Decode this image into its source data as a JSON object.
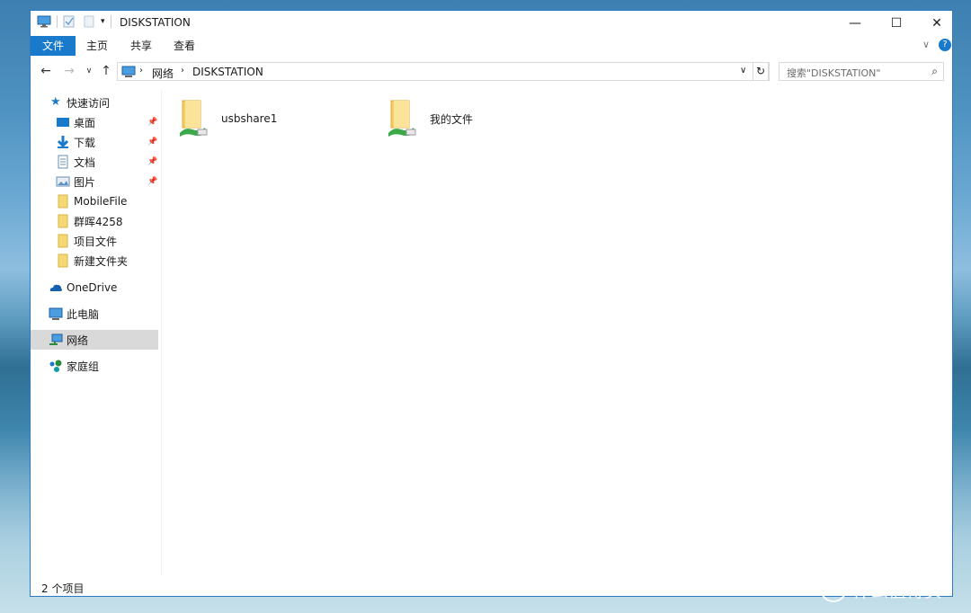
{
  "window": {
    "title": "DISKSTATION",
    "controls": {
      "minimize": "—",
      "maximize": "☐",
      "close": "✕"
    }
  },
  "ribbon": {
    "tabs": [
      "文件",
      "主页",
      "共享",
      "查看"
    ]
  },
  "address": {
    "breadcrumb": [
      "网络",
      "DISKSTATION"
    ],
    "search_placeholder": "搜索\"DISKSTATION\""
  },
  "sidebar": {
    "quick_access": "快速访问",
    "pinned": [
      {
        "label": "桌面",
        "icon": "desktop-icon"
      },
      {
        "label": "下载",
        "icon": "download-icon"
      },
      {
        "label": "文档",
        "icon": "document-icon"
      },
      {
        "label": "图片",
        "icon": "pictures-icon"
      }
    ],
    "folders": [
      "MobileFile",
      "群晖4258",
      "项目文件",
      "新建文件夹"
    ],
    "onedrive": "OneDrive",
    "this_pc": "此电脑",
    "network": "网络",
    "homegroup": "家庭组"
  },
  "content": {
    "items": [
      {
        "name": "usbshare1",
        "icon": "shared-folder-icon"
      },
      {
        "name": "我的文件",
        "icon": "shared-folder-icon"
      }
    ]
  },
  "status": {
    "item_count": "2 个项目"
  },
  "watermark": {
    "text": "什么值得买"
  }
}
